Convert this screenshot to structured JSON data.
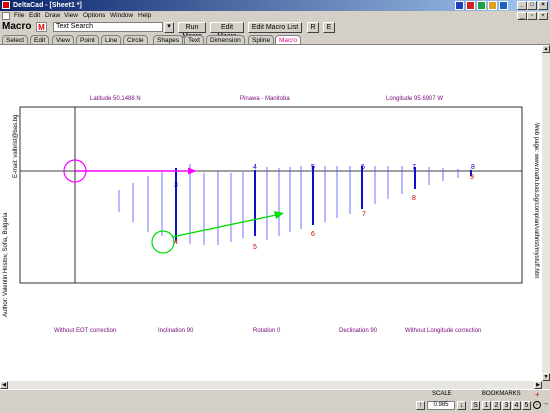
{
  "window": {
    "title": "DeltaCad - [Sheet1 *]"
  },
  "menu": [
    "File",
    "Edit",
    "Draw",
    "View",
    "Options",
    "Window",
    "Help"
  ],
  "toolbar": {
    "macro_label": "Macro",
    "macro_icon_letter": "M",
    "search_value": "Text Search",
    "run_macro": "Run Macro",
    "edit_macro": "Edit Macro",
    "edit_macro_list": "Edit Macro List",
    "r_button": "R",
    "e_button": "E"
  },
  "tabs": [
    "Select",
    "Edit",
    "View",
    "Point",
    "Line",
    "Circle",
    "Shapes",
    "Text",
    "Dimension",
    "Spline",
    "Macro"
  ],
  "active_tab": "Macro",
  "drawing": {
    "top_labels": {
      "latitude": "Latitude 50.1488 N",
      "place": "Pinawa - Manitoba",
      "longitude": "Longitude 95.6907 W"
    },
    "bottom_labels": {
      "eot": "Without EOT correction",
      "inclination": "Inclination 90",
      "rotation": "Rotation 0",
      "declination": "Declination 90",
      "longitude_corr": "Without Longitude correction"
    },
    "left_author": "Author: Valentin Hristov, Sofia, Bulgaria",
    "left_email": "E-mail: valhrist@bas.bg",
    "right_web": "Web page: www.math.bas.bg/complan/valhrist/mystuff.htm",
    "hour_numbers_top": [
      "3",
      "4",
      "5",
      "6",
      "7",
      "8"
    ],
    "hour_numbers_bottom": [
      "4",
      "5",
      "6",
      "7",
      "8",
      "9"
    ],
    "colors": {
      "hour_top": "#0000cc",
      "hour_bottom": "#cc0000",
      "magenta": "#ff00ff",
      "green": "#00dd00",
      "label": "#7a0a7a",
      "lines": "#5050ff"
    }
  },
  "status": {
    "scale_label": "SCALE",
    "scale_value": "0.985",
    "bookmarks_label": "BOOKMARKS",
    "bookmark_s": "S",
    "bookmarks": [
      "1",
      "2",
      "3",
      "4",
      "5"
    ]
  }
}
